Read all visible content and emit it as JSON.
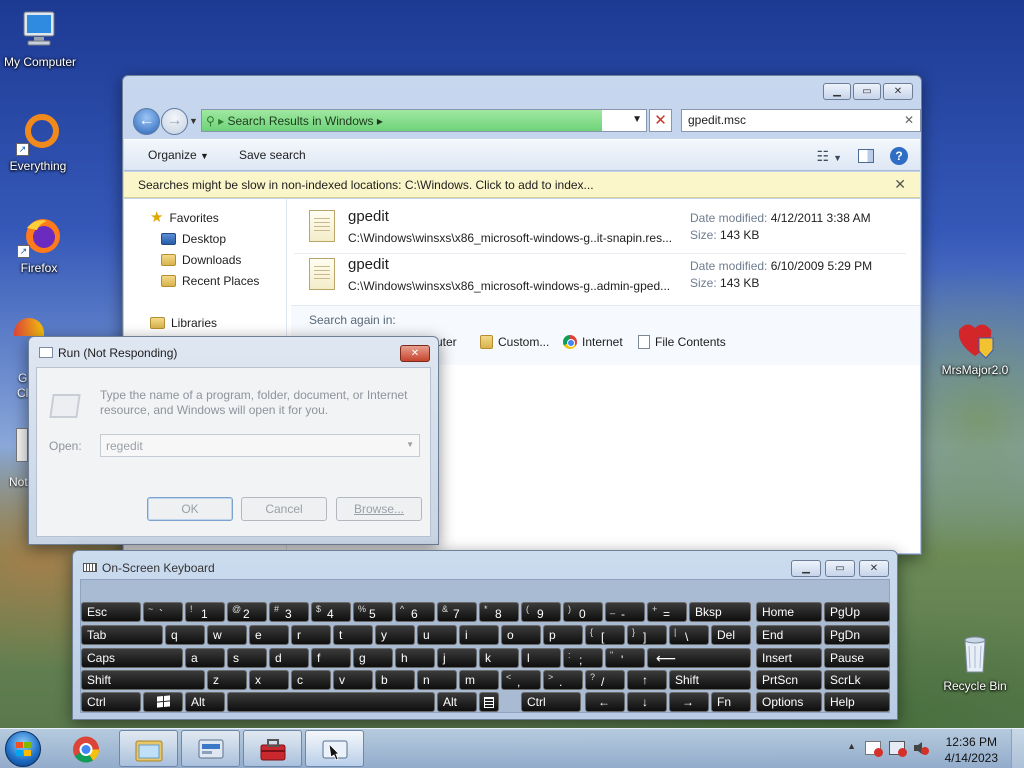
{
  "desktop": {
    "icons": [
      {
        "label": "My Computer"
      },
      {
        "label": "Everything"
      },
      {
        "label": "Firefox"
      },
      {
        "label": "Google Chrome",
        "partial": "G\nCl"
      },
      {
        "label": "Notepad",
        "partial": "Not"
      },
      {
        "label": "MrsMajor2.0"
      },
      {
        "label": "Recycle Bin"
      }
    ],
    "partial_chrome_1": "G",
    "partial_chrome_2": "Cl",
    "partial_notepad": "Not"
  },
  "explorer": {
    "address": "Search Results in Windows",
    "search_value": "gpedit.msc",
    "toolbar": {
      "organize": "Organize",
      "save_search": "Save search"
    },
    "info_bar": "Searches might be slow in non-indexed locations: C:\\Windows. Click to add to index...",
    "nav": {
      "favorites": "Favorites",
      "desktop": "Desktop",
      "downloads": "Downloads",
      "recent": "Recent Places",
      "libraries": "Libraries"
    },
    "results": [
      {
        "name": "gpedit",
        "path": "C:\\Windows\\winsxs\\x86_microsoft-windows-g..it-snapin.res...",
        "date_label": "Date modified:",
        "date": "4/12/2011 3:38 AM",
        "size_label": "Size:",
        "size": "143 KB"
      },
      {
        "name": "gpedit",
        "path": "C:\\Windows\\winsxs\\x86_microsoft-windows-g..admin-gped...",
        "date_label": "Date modified:",
        "date": "6/10/2009 5:29 PM",
        "size_label": "Size:",
        "size": "143 KB"
      }
    ],
    "search_again": {
      "label": "Search again in:",
      "computer": "uter",
      "custom": "Custom...",
      "internet": "Internet",
      "file_contents": "File Contents"
    }
  },
  "run": {
    "title": "Run (Not Responding)",
    "description": "Type the name of a program, folder, document, or Internet resource, and Windows will open it for you.",
    "open_label": "Open:",
    "open_value": "regedit",
    "ok": "OK",
    "cancel": "Cancel",
    "browse": "Browse..."
  },
  "osk": {
    "title": "On-Screen Keyboard",
    "keys": {
      "esc": "Esc",
      "tilde_top": "~",
      "tilde": "`",
      "n1_top": "!",
      "n1": "1",
      "n2_top": "@",
      "n2": "2",
      "n3_top": "#",
      "n3": "3",
      "n4_top": "$",
      "n4": "4",
      "n5_top": "%",
      "n5": "5",
      "n6_top": "^",
      "n6": "6",
      "n7_top": "&",
      "n7": "7",
      "n8_top": "*",
      "n8": "8",
      "n9_top": "(",
      "n9": "9",
      "n0_top": ")",
      "n0": "0",
      "minus_top": "_",
      "minus": "-",
      "eq_top": "+",
      "eq": "=",
      "bksp": "Bksp",
      "home": "Home",
      "pgup": "PgUp",
      "tab": "Tab",
      "q": "q",
      "w": "w",
      "e": "e",
      "r": "r",
      "t": "t",
      "y": "y",
      "u": "u",
      "i": "i",
      "o": "o",
      "p": "p",
      "lbr_top": "{",
      "lbr": "[",
      "rbr_top": "}",
      "rbr": "]",
      "bs_top": "|",
      "bs": "\\",
      "del": "Del",
      "end": "End",
      "pgdn": "PgDn",
      "caps": "Caps",
      "a": "a",
      "s": "s",
      "d": "d",
      "f": "f",
      "g": "g",
      "h": "h",
      "j": "j",
      "k": "k",
      "l": "l",
      "semi_top": ":",
      "semi": ";",
      "quote_top": "\"",
      "quote": "'",
      "enter": "⟵",
      "insert": "Insert",
      "pause": "Pause",
      "shift_l": "Shift",
      "z": "z",
      "x": "x",
      "c": "c",
      "v": "v",
      "b": "b",
      "n": "n",
      "m": "m",
      "comma_top": "<",
      "comma": ",",
      "period_top": ">",
      "period": ".",
      "slash_top": "?",
      "slash": "/",
      "up": "↑",
      "shift_r": "Shift",
      "prtscn": "PrtScn",
      "scrlk": "ScrLk",
      "ctrl_l": "Ctrl",
      "win": "win-icon",
      "alt_l": "Alt",
      "alt_r": "Alt",
      "menu": "menu-icon",
      "ctrl_r": "Ctrl",
      "left": "←",
      "down": "↓",
      "right": "→",
      "fn": "Fn",
      "options": "Options",
      "help": "Help"
    }
  },
  "taskbar": {
    "time": "12:36 PM",
    "date": "4/14/2023",
    "tray_overflow": "▲"
  },
  "colors": {
    "address_progress": "#6fd37a",
    "info_bar_bg": "#fbf6c9",
    "close_red": "#c7442c",
    "key_bg": "#0e0e0e"
  }
}
